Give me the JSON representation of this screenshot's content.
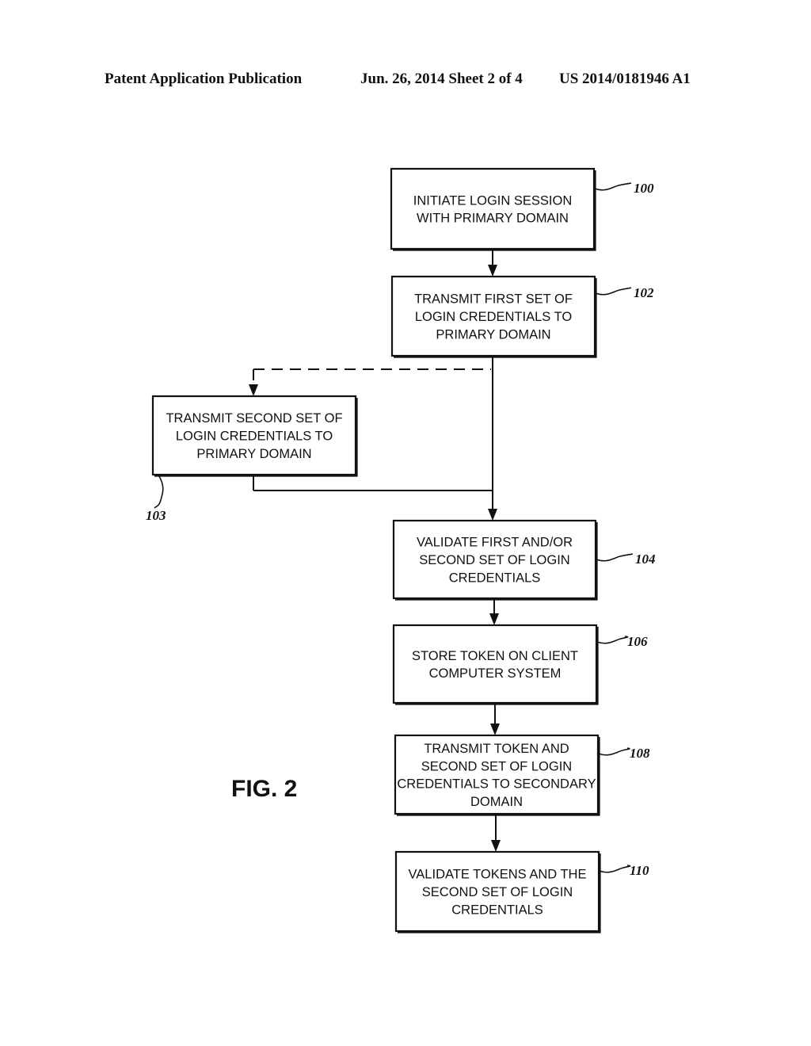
{
  "header": {
    "left": "Patent Application Publication",
    "middle": "Jun. 26, 2014  Sheet 2 of 4",
    "right": "US 2014/0181946 A1"
  },
  "figure_label": "FIG. 2",
  "steps": [
    {
      "id": "100",
      "ref": "100",
      "lines": [
        "INITIATE LOGIN SESSION",
        "WITH PRIMARY DOMAIN"
      ]
    },
    {
      "id": "102",
      "ref": "102",
      "lines": [
        "TRANSMIT FIRST SET OF",
        "LOGIN CREDENTIALS TO",
        "PRIMARY DOMAIN"
      ]
    },
    {
      "id": "103",
      "ref": "103",
      "lines": [
        "TRANSMIT SECOND SET OF",
        "LOGIN CREDENTIALS TO",
        "PRIMARY DOMAIN"
      ],
      "optional": true
    },
    {
      "id": "104",
      "ref": "104",
      "lines": [
        "VALIDATE FIRST AND/OR",
        "SECOND SET OF LOGIN",
        "CREDENTIALS"
      ]
    },
    {
      "id": "106",
      "ref": "106",
      "lines": [
        "STORE TOKEN ON CLIENT",
        "COMPUTER SYSTEM"
      ]
    },
    {
      "id": "108",
      "ref": "108",
      "lines": [
        "TRANSMIT TOKEN AND",
        "SECOND SET OF LOGIN",
        "CREDENTIALS TO SECONDARY",
        "DOMAIN"
      ]
    },
    {
      "id": "110",
      "ref": "110",
      "lines": [
        "VALIDATE TOKENS AND THE",
        "SECOND SET OF LOGIN",
        "CREDENTIALS"
      ]
    }
  ],
  "connections": [
    {
      "from": "100",
      "to": "102",
      "style": "solid"
    },
    {
      "from": "102",
      "to": "103",
      "style": "dashed"
    },
    {
      "from": "102",
      "to": "104",
      "style": "solid"
    },
    {
      "from": "103",
      "to": "104",
      "style": "solid"
    },
    {
      "from": "104",
      "to": "106",
      "style": "solid"
    },
    {
      "from": "106",
      "to": "108",
      "style": "solid"
    },
    {
      "from": "108",
      "to": "110",
      "style": "solid"
    }
  ]
}
